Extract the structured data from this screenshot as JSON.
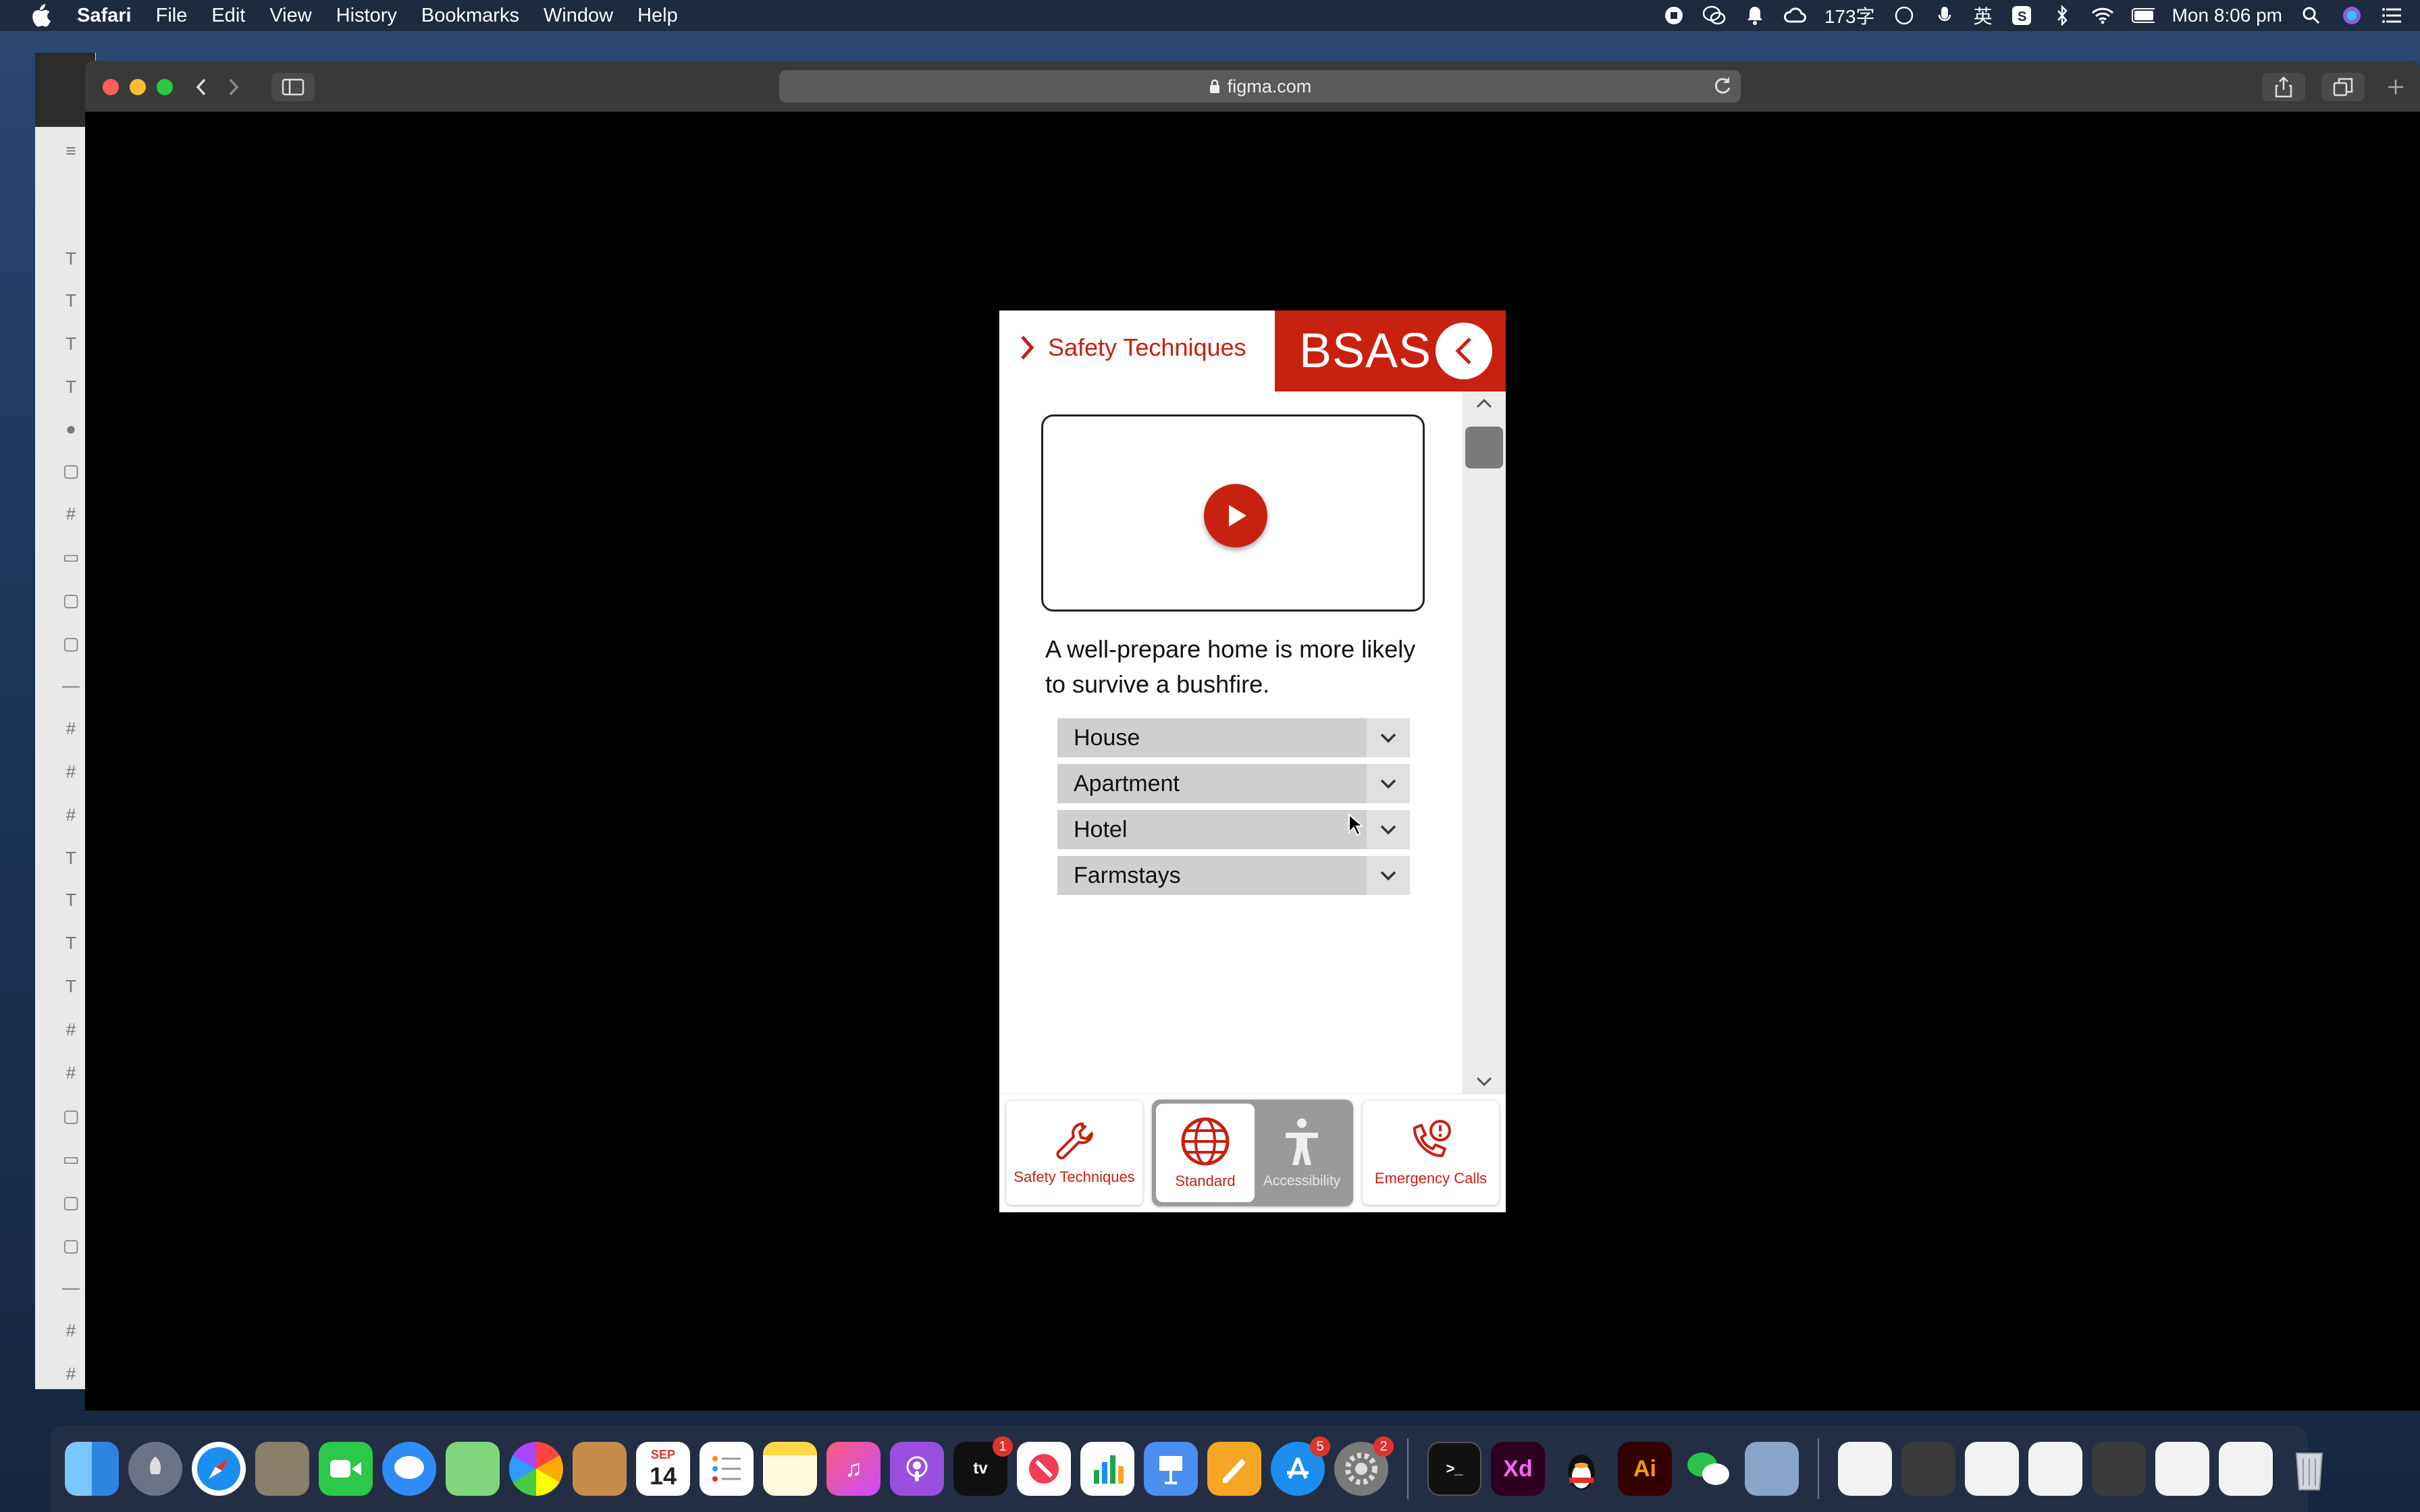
{
  "menubar": {
    "app_name": "Safari",
    "items": [
      "File",
      "Edit",
      "View",
      "History",
      "Bookmarks",
      "Window",
      "Help"
    ],
    "status_text": "173字",
    "ime": "英",
    "clock": "Mon 8:06 pm"
  },
  "browser": {
    "url": "figma.com"
  },
  "prototype": {
    "breadcrumb": "Safety Techniques",
    "brand": "BSAS",
    "intro_text": "A well-prepare home is more likely to survive a bushfire.",
    "accordion": [
      "House",
      "Apartment",
      "Hotel",
      "Farmstays"
    ],
    "tabs": {
      "safety": "Safety Techniques",
      "standard": "Standard",
      "accessibility": "Accessibility",
      "emergency": "Emergency Calls"
    },
    "colors": {
      "accent": "#c8210f",
      "row_bg": "#cfcfcf",
      "toggle_bg": "#e0e0e0"
    }
  },
  "dock": {
    "calendar_month": "SEP",
    "calendar_day": "14",
    "badges": {
      "tv": "1",
      "appstore": "5",
      "settings": "2"
    },
    "xd": "Xd",
    "ai": "Ai"
  }
}
